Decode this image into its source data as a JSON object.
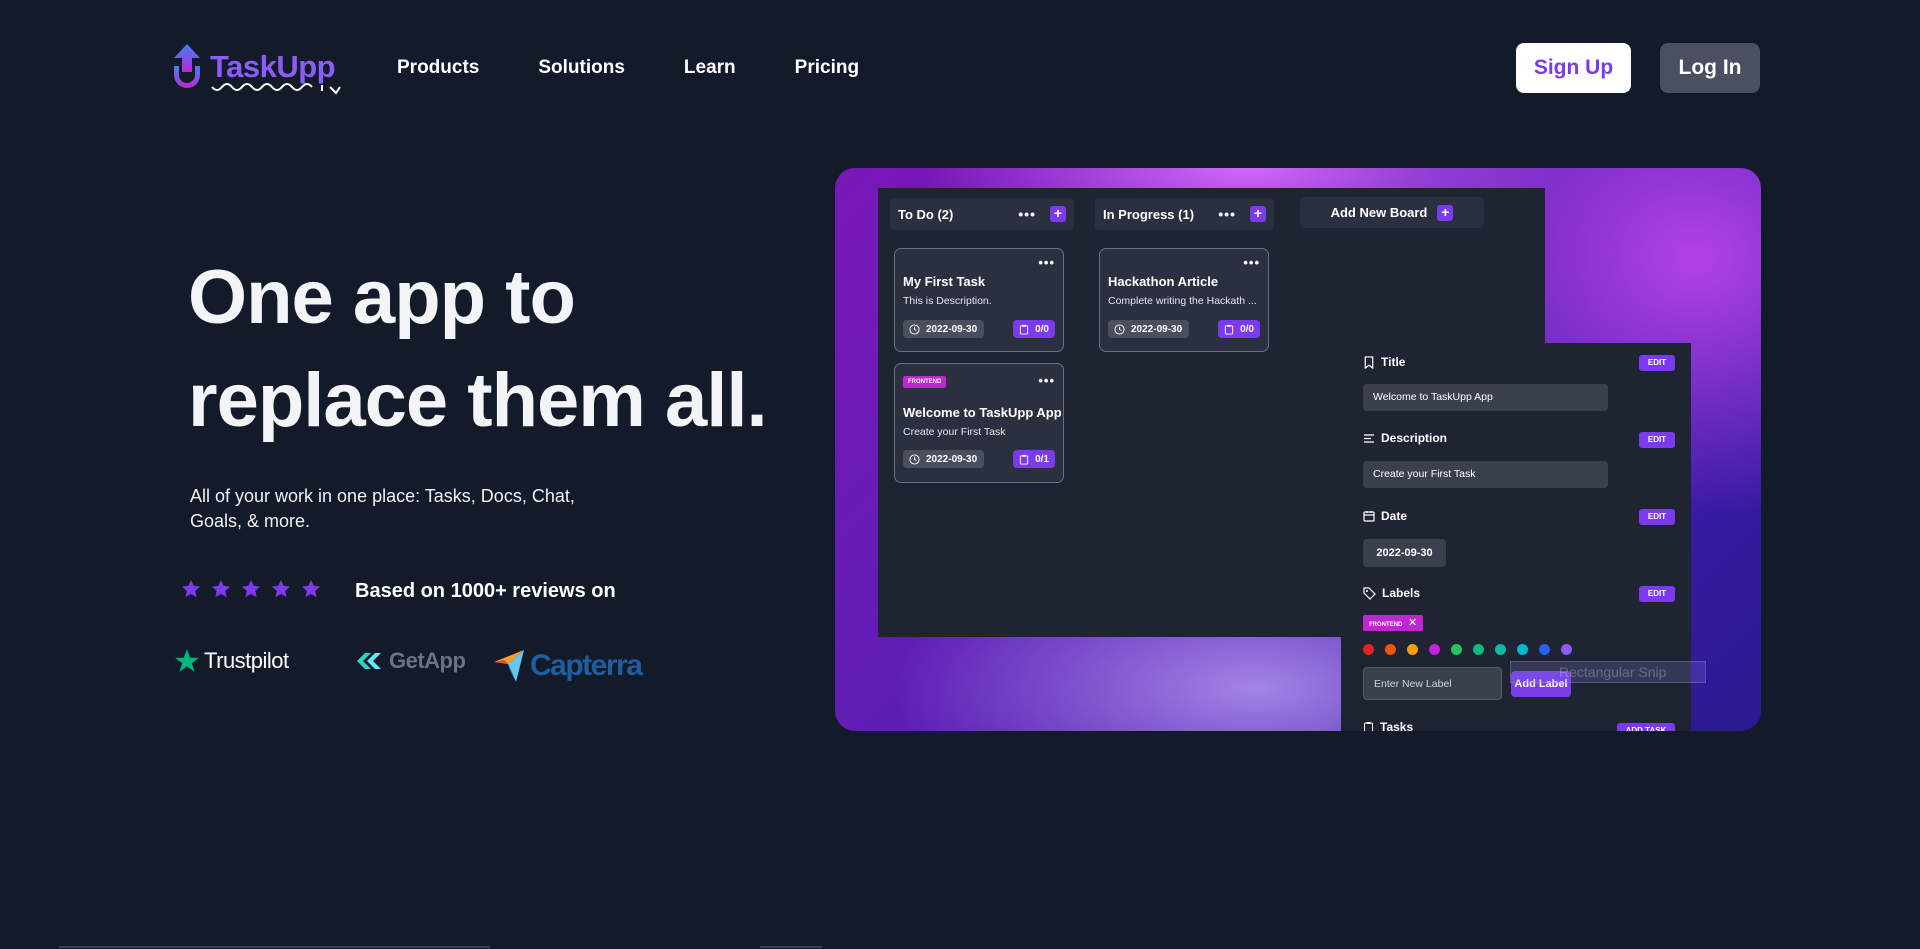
{
  "brand": {
    "name": "TaskUpp",
    "accent": "#8b5cf6"
  },
  "nav": {
    "links": [
      "Products",
      "Solutions",
      "Learn",
      "Pricing"
    ],
    "signup_label": "Sign Up",
    "login_label": "Log In"
  },
  "hero": {
    "headline_line1": "One app to",
    "headline_line2": "replace them all.",
    "subtext": "All of your work in one place: Tasks, Docs, Chat, Goals, & more.",
    "rating_stars": 5,
    "reviews_text": "Based on 1000+ reviews on",
    "review_sites": [
      "Trustpilot",
      "GetApp",
      "Capterra"
    ]
  },
  "preview": {
    "columns": [
      {
        "title": "To Do (2)"
      },
      {
        "title": "In Progress (1)"
      }
    ],
    "add_board_label": "Add New Board",
    "cards": [
      {
        "title": "My First Task",
        "desc": "This is Description.",
        "date": "2022-09-30",
        "tasks": "0/0"
      },
      {
        "title": "Hackathon Article",
        "desc": "Complete writing the Hackath ...",
        "date": "2022-09-30",
        "tasks": "0/0"
      },
      {
        "tag": "FRONTEND",
        "title": "Welcome to TaskUpp App",
        "desc": "Create your First Task",
        "date": "2022-09-30",
        "tasks": "0/1"
      }
    ],
    "detail": {
      "edit_label": "EDIT",
      "title_label": "Title",
      "title_value": "Welcome to TaskUpp App",
      "description_label": "Description",
      "description_value": "Create your First Task",
      "date_label": "Date",
      "date_value": "2022-09-30",
      "labels_label": "Labels",
      "label_tag": "FRONTEND",
      "label_colors": [
        "#dc2626",
        "#ea580c",
        "#f59e0b",
        "#c026d3",
        "#22c55e",
        "#10b981",
        "#14b8a6",
        "#06b6d4",
        "#2563eb",
        "#8b5cf6"
      ],
      "new_label_placeholder": "Enter New Label",
      "add_label_button": "Add Label",
      "tasks_label": "Tasks",
      "add_task_button": "ADD TASK"
    },
    "snip_overlay_text": "Rectangular Snip"
  }
}
